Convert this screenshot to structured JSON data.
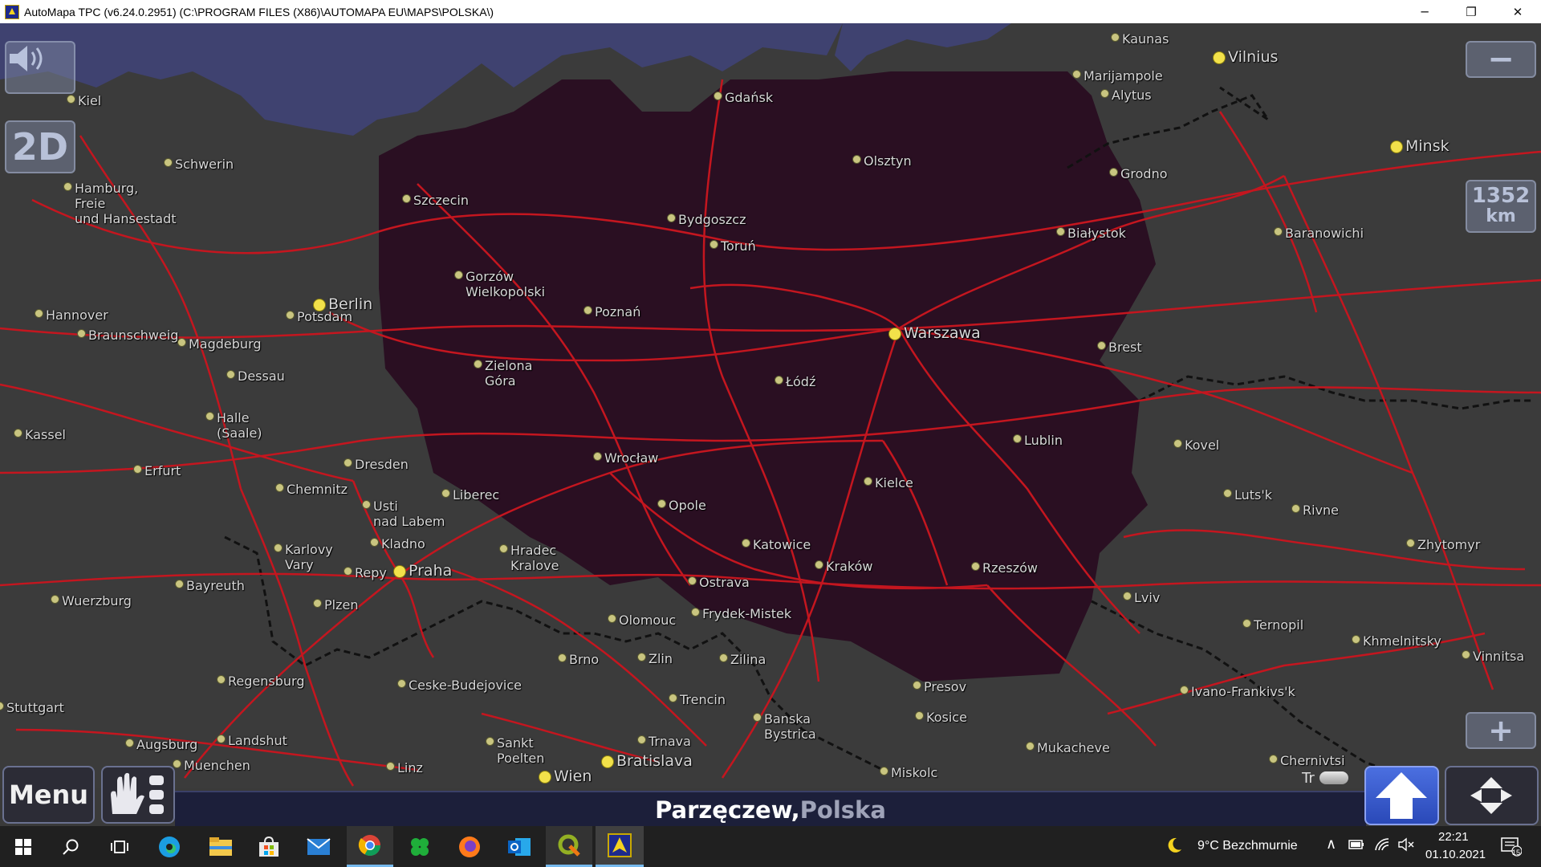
{
  "window": {
    "title": "AutoMapa TPC (v6.24.0.2951) (C:\\PROGRAM FILES (X86)\\AUTOMAPA EU\\MAPS\\POLSKA\\)",
    "buttons": [
      "minimize-icon",
      "restore-icon",
      "close-icon"
    ]
  },
  "map": {
    "view_mode": "2D",
    "scale_value": "1352",
    "scale_unit": "km",
    "zoom_out_label": "−",
    "zoom_in_label": "+",
    "colors": {
      "land": "#3b3b3b",
      "sea": "#3f4270",
      "poland": "#2a0f22",
      "roads": "#c4161f",
      "borders": "#111111"
    },
    "cities": [
      {
        "name": "Kaunas",
        "cap": false
      },
      {
        "name": "Vilnius",
        "cap": true
      },
      {
        "name": "Marijampole",
        "cap": false
      },
      {
        "name": "Alytus",
        "cap": false
      },
      {
        "name": "Gdańsk",
        "cap": false
      },
      {
        "name": "Kiel",
        "cap": false
      },
      {
        "name": "Minsk",
        "cap": true
      },
      {
        "name": "Schwerin",
        "cap": false
      },
      {
        "name": "Olsztyn",
        "cap": false
      },
      {
        "name": "Grodno",
        "cap": false
      },
      {
        "name": "Hamburg,\nFreie\nund Hansestadt",
        "cap": false
      },
      {
        "name": "Szczecin",
        "cap": false
      },
      {
        "name": "Bydgoszcz",
        "cap": false
      },
      {
        "name": "Toruń",
        "cap": false
      },
      {
        "name": "Białystok",
        "cap": false
      },
      {
        "name": "Baranowichi",
        "cap": false
      },
      {
        "name": "Gorzów\nWielkopolski",
        "cap": false
      },
      {
        "name": "Berlin",
        "cap": true
      },
      {
        "name": "Hannover",
        "cap": false
      },
      {
        "name": "Potsdam",
        "cap": false
      },
      {
        "name": "Poznań",
        "cap": false
      },
      {
        "name": "Warszawa",
        "cap": true
      },
      {
        "name": "Braunschweig",
        "cap": false
      },
      {
        "name": "Magdeburg",
        "cap": false
      },
      {
        "name": "Brest",
        "cap": false
      },
      {
        "name": "Dessau",
        "cap": false
      },
      {
        "name": "Zielona\nGóra",
        "cap": false
      },
      {
        "name": "Łódź",
        "cap": false
      },
      {
        "name": "Halle\n(Saale)",
        "cap": false
      },
      {
        "name": "Kassel",
        "cap": false
      },
      {
        "name": "Lublin",
        "cap": false
      },
      {
        "name": "Kovel",
        "cap": false
      },
      {
        "name": "Dresden",
        "cap": false
      },
      {
        "name": "Wrocław",
        "cap": false
      },
      {
        "name": "Erfurt",
        "cap": false
      },
      {
        "name": "Chemnitz",
        "cap": false
      },
      {
        "name": "Liberec",
        "cap": false
      },
      {
        "name": "Kielce",
        "cap": false
      },
      {
        "name": "Luts'k",
        "cap": false
      },
      {
        "name": "Usti\nnad Labem",
        "cap": false
      },
      {
        "name": "Opole",
        "cap": false
      },
      {
        "name": "Rivne",
        "cap": false
      },
      {
        "name": "Kladno",
        "cap": false
      },
      {
        "name": "Karlovy\nVary",
        "cap": false
      },
      {
        "name": "Hradec\nKralove",
        "cap": false
      },
      {
        "name": "Katowice",
        "cap": false
      },
      {
        "name": "Zhytomyr",
        "cap": false
      },
      {
        "name": "Repy",
        "cap": false
      },
      {
        "name": "Praha",
        "cap": true
      },
      {
        "name": "Kraków",
        "cap": false
      },
      {
        "name": "Rzeszów",
        "cap": false
      },
      {
        "name": "Bayreuth",
        "cap": false
      },
      {
        "name": "Ostrava",
        "cap": false
      },
      {
        "name": "Lviv",
        "cap": false
      },
      {
        "name": "Wuerzburg",
        "cap": false
      },
      {
        "name": "Plzen",
        "cap": false
      },
      {
        "name": "Frydek-Mistek",
        "cap": false
      },
      {
        "name": "Olomouc",
        "cap": false
      },
      {
        "name": "Ternopil",
        "cap": false
      },
      {
        "name": "Khmelnitsky",
        "cap": false
      },
      {
        "name": "Brno",
        "cap": false
      },
      {
        "name": "Zlin",
        "cap": false
      },
      {
        "name": "Zilina",
        "cap": false
      },
      {
        "name": "Vinnitsa",
        "cap": false
      },
      {
        "name": "Regensburg",
        "cap": false
      },
      {
        "name": "Presov",
        "cap": false
      },
      {
        "name": "Ceske-Budejovice",
        "cap": false
      },
      {
        "name": "Ivano-Frankivs'k",
        "cap": false
      },
      {
        "name": "Trencin",
        "cap": false
      },
      {
        "name": "Stuttgart",
        "cap": false
      },
      {
        "name": "Banska\nBystrica",
        "cap": false
      },
      {
        "name": "Kosice",
        "cap": false
      },
      {
        "name": "Trnava",
        "cap": false
      },
      {
        "name": "Landshut",
        "cap": false
      },
      {
        "name": "Augsburg",
        "cap": false
      },
      {
        "name": "Sankt\nPoelten",
        "cap": false
      },
      {
        "name": "Mukacheve",
        "cap": false
      },
      {
        "name": "Bratislava",
        "cap": true
      },
      {
        "name": "Muenchen",
        "cap": false
      },
      {
        "name": "Linz",
        "cap": false
      },
      {
        "name": "Miskolc",
        "cap": false
      },
      {
        "name": "Chernivtsi",
        "cap": false
      },
      {
        "name": "Wien",
        "cap": true
      }
    ]
  },
  "bottom": {
    "menu_label": "Menu",
    "location_place": "Parzęczew,",
    "location_country": " Polska",
    "traffic_label": "Tr"
  },
  "taskbar": {
    "apps": [
      "windows-start-icon",
      "search-icon",
      "task-view-icon",
      "edge-icon",
      "file-explorer-icon",
      "store-icon",
      "mail-icon",
      "chrome-icon",
      "clover-icon",
      "firefox-icon",
      "outlook-icon",
      "qgis-icon",
      "automapa-icon"
    ],
    "weather": "9°C  Bezchmurnie",
    "time": "22:21",
    "date": "01.10.2021",
    "notifications": "15"
  }
}
